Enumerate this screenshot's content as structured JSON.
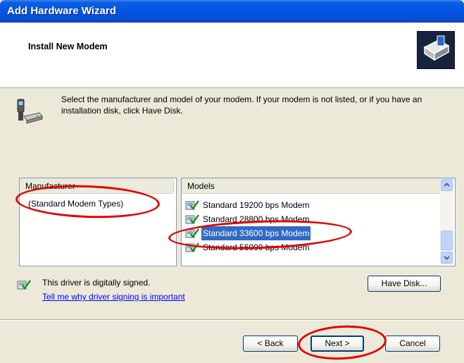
{
  "window": {
    "title": "Add Hardware Wizard"
  },
  "header": {
    "title": "Install New Modem",
    "icon": "hardware-wizard-icon"
  },
  "instructions": {
    "icon": "modem-phone-icon",
    "text": "Select the manufacturer and model of your modem. If your modem is not listed, or if you have an installation disk, click Have Disk."
  },
  "manufacturer_list": {
    "header": "Manufacturer",
    "items": [
      "(Standard Modem Types)"
    ],
    "selected": "(Standard Modem Types)"
  },
  "models_list": {
    "header": "Models",
    "item_icon": "signed-driver-icon",
    "items": [
      {
        "label": "Standard 19200 bps Modem"
      },
      {
        "label": "Standard 28800 bps Modem"
      },
      {
        "label": "Standard 33600 bps Modem",
        "selected": true
      },
      {
        "label": "Standard 56000 bps Modem"
      }
    ]
  },
  "driver_signing": {
    "icon": "signed-driver-icon",
    "text": "This driver is digitally signed.",
    "link": "Tell me why driver signing is important"
  },
  "buttons": {
    "have_disk": "Have Disk...",
    "back": "< Back",
    "next": "Next >",
    "cancel": "Cancel"
  },
  "colors": {
    "title_bar": "#0054e3",
    "dialog_bg": "#ece9d8",
    "selection": "#316ac5",
    "annotation": "#e00000"
  }
}
